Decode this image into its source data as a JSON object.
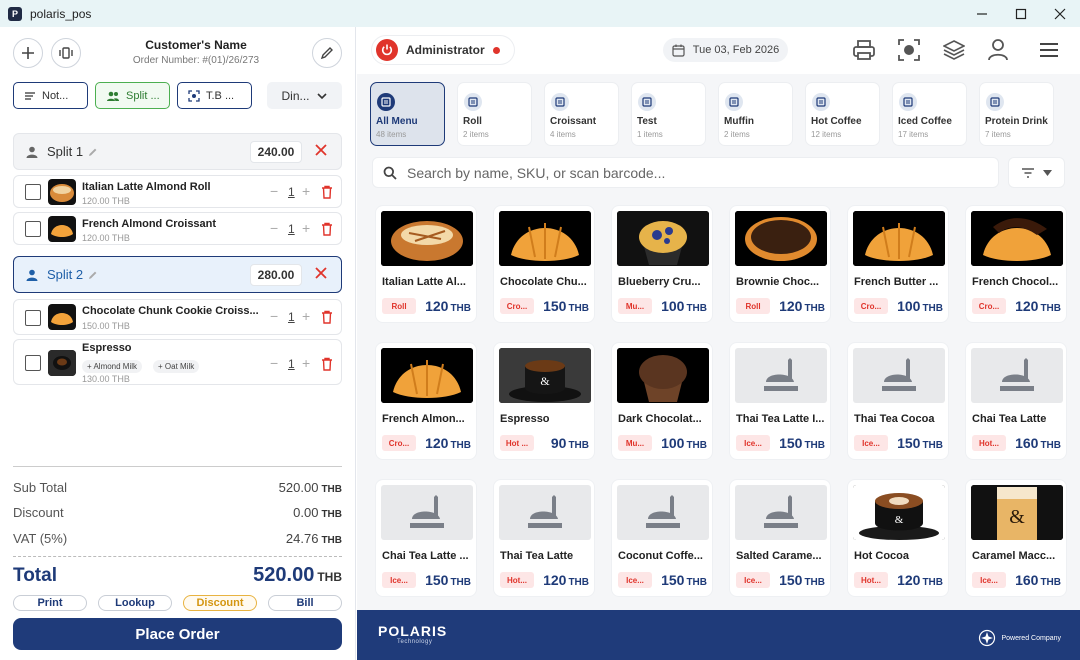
{
  "window": {
    "title": "polaris_pos",
    "app_icon": "P"
  },
  "order": {
    "customer_name": "Customer's Name",
    "order_number": "Order Number: #(01)/26/273",
    "chips": {
      "notes": "Not...",
      "split": "Split ...",
      "table": "T.B ...",
      "dine": "Din..."
    },
    "splits": [
      {
        "name": "Split 1",
        "amount": "240.00",
        "items": [
          {
            "name": "Italian Latte Almond Roll",
            "price": "120.00 THB",
            "qty": "1"
          },
          {
            "name": "French Almond Croissant",
            "price": "120.00 THB",
            "qty": "1"
          }
        ]
      },
      {
        "name": "Split 2",
        "amount": "280.00",
        "items": [
          {
            "name": "Chocolate Chunk Cookie Croiss...",
            "price": "150.00 THB",
            "qty": "1"
          },
          {
            "name": "Espresso",
            "price": "130.00 THB",
            "qty": "1",
            "modifiers": [
              "+ Almond Milk",
              "+ Oat Milk"
            ]
          }
        ]
      }
    ],
    "summary": {
      "subtotal_label": "Sub Total",
      "subtotal": "520.00",
      "discount_label": "Discount",
      "discount": "0.00",
      "vat_label": "VAT (5%)",
      "vat": "24.76",
      "total_label": "Total",
      "total": "520.00",
      "currency": "THB"
    },
    "actions": {
      "print": "Print",
      "lookup": "Lookup",
      "discount": "Discount",
      "bill": "Bill"
    },
    "place_order": "Place Order"
  },
  "header": {
    "user": "Administrator",
    "date": "Tue 03, Feb 2026"
  },
  "categories": [
    {
      "name": "All Menu",
      "count": "48 items"
    },
    {
      "name": "Roll",
      "count": "2 items"
    },
    {
      "name": "Croissant",
      "count": "4 items"
    },
    {
      "name": "Test",
      "count": "1 items"
    },
    {
      "name": "Muffin",
      "count": "2 items"
    },
    {
      "name": "Hot Coffee",
      "count": "12 items"
    },
    {
      "name": "Iced Coffee",
      "count": "17 items"
    },
    {
      "name": "Protein Drink",
      "count": "7 items"
    }
  ],
  "search": {
    "placeholder": "Search by name, SKU, or scan barcode..."
  },
  "products": [
    {
      "name": "Italian Latte Al...",
      "tag": "Roll",
      "price": "120",
      "img": "roll"
    },
    {
      "name": "Chocolate Chu...",
      "tag": "Cro...",
      "price": "150",
      "img": "croissant"
    },
    {
      "name": "Blueberry Cru...",
      "tag": "Mu...",
      "price": "100",
      "img": "muffin-blue"
    },
    {
      "name": "Brownie Choc...",
      "tag": "Roll",
      "price": "120",
      "img": "brownie"
    },
    {
      "name": "French Butter ...",
      "tag": "Cro...",
      "price": "100",
      "img": "croissant"
    },
    {
      "name": "French Chocol...",
      "tag": "Cro...",
      "price": "120",
      "img": "croissant-choc"
    },
    {
      "name": "French Almon...",
      "tag": "Cro...",
      "price": "120",
      "img": "croissant"
    },
    {
      "name": "Espresso",
      "tag": "Hot ...",
      "price": "90",
      "img": "espresso"
    },
    {
      "name": "Dark Chocolat...",
      "tag": "Mu...",
      "price": "100",
      "img": "muffin-dark"
    },
    {
      "name": "Thai Tea Latte I...",
      "tag": "Ice...",
      "price": "150",
      "img": "placeholder"
    },
    {
      "name": "Thai Tea Cocoa",
      "tag": "Ice...",
      "price": "150",
      "img": "placeholder"
    },
    {
      "name": "Chai Tea Latte",
      "tag": "Hot...",
      "price": "160",
      "img": "placeholder"
    },
    {
      "name": "Chai Tea Latte ...",
      "tag": "Ice...",
      "price": "150",
      "img": "placeholder"
    },
    {
      "name": "Thai Tea Latte",
      "tag": "Hot...",
      "price": "120",
      "img": "placeholder"
    },
    {
      "name": "Coconut Coffe...",
      "tag": "Ice...",
      "price": "150",
      "img": "placeholder"
    },
    {
      "name": "Salted Carame...",
      "tag": "Ice...",
      "price": "150",
      "img": "placeholder"
    },
    {
      "name": "Hot Cocoa",
      "tag": "Hot...",
      "price": "120",
      "img": "latte-art"
    },
    {
      "name": "Caramel Macc...",
      "tag": "Ice...",
      "price": "160",
      "img": "iced-glass"
    }
  ],
  "currency": "THB",
  "footer": {
    "brand": "POLARIS",
    "brand_sub": "Technology",
    "powered": "Powered Company"
  },
  "colors": {
    "primary": "#1f3b7a",
    "accent_red": "#e0342b",
    "split_green": "#4caf50",
    "discount_gold": "#e8b341"
  }
}
